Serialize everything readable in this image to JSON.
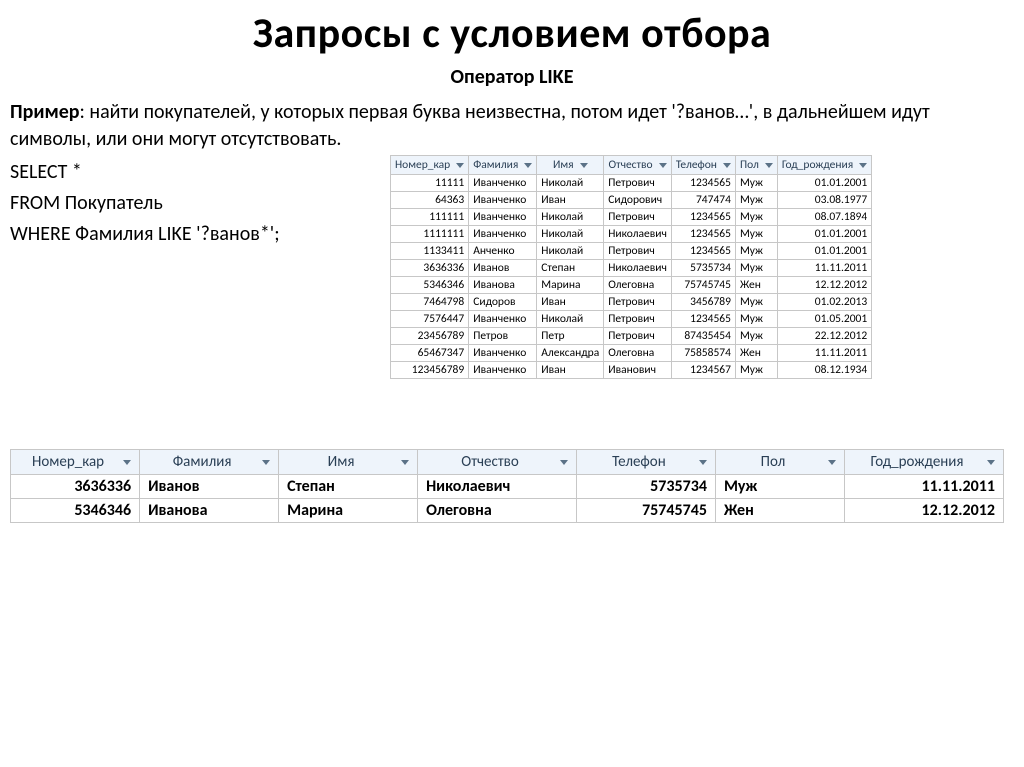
{
  "title": "Запросы с условием отбора",
  "subtitle": "Оператор LIKE",
  "example_label": "Пример",
  "example_text": ": найти покупателей, у которых первая буква неизвестна, потом идет '?ванов…', в дальнейшем идут символы, или они могут отсутствовать.",
  "sql": {
    "l1": "SELECT *",
    "l2": "FROM Покупатель",
    "l3": "WHERE Фамилия LIKE '?ванов*';"
  },
  "columns": {
    "c1": "Номер_кар",
    "c2": "Фамилия",
    "c3": "Имя",
    "c4": "Отчество",
    "c5": "Телефон",
    "c6": "Пол",
    "c7": "Год_рождения"
  },
  "columns_result": {
    "c1": "Номер_кар"
  },
  "rows": [
    {
      "num": "11111",
      "fam": "Иванченко",
      "name": "Николай",
      "otch": "Петрович",
      "tel": "1234565",
      "pol": "Муж",
      "yr": "01.01.2001"
    },
    {
      "num": "64363",
      "fam": "Иванченко",
      "name": "Иван",
      "otch": "Сидорович",
      "tel": "747474",
      "pol": "Муж",
      "yr": "03.08.1977"
    },
    {
      "num": "111111",
      "fam": "Иванченко",
      "name": "Николай",
      "otch": "Петрович",
      "tel": "1234565",
      "pol": "Муж",
      "yr": "08.07.1894"
    },
    {
      "num": "1111111",
      "fam": "Иванченко",
      "name": "Николай",
      "otch": "Николаевич",
      "tel": "1234565",
      "pol": "Муж",
      "yr": "01.01.2001"
    },
    {
      "num": "1133411",
      "fam": "Анченко",
      "name": "Николай",
      "otch": "Петрович",
      "tel": "1234565",
      "pol": "Муж",
      "yr": "01.01.2001"
    },
    {
      "num": "3636336",
      "fam": "Иванов",
      "name": "Степан",
      "otch": "Николаевич",
      "tel": "5735734",
      "pol": "Муж",
      "yr": "11.11.2011"
    },
    {
      "num": "5346346",
      "fam": "Иванова",
      "name": "Марина",
      "otch": "Олеговна",
      "tel": "75745745",
      "pol": "Жен",
      "yr": "12.12.2012"
    },
    {
      "num": "7464798",
      "fam": "Сидоров",
      "name": "Иван",
      "otch": "Петрович",
      "tel": "3456789",
      "pol": "Муж",
      "yr": "01.02.2013"
    },
    {
      "num": "7576447",
      "fam": "Иванченко",
      "name": "Николай",
      "otch": "Петрович",
      "tel": "1234565",
      "pol": "Муж",
      "yr": "01.05.2001"
    },
    {
      "num": "23456789",
      "fam": "Петров",
      "name": "Петр",
      "otch": "Петрович",
      "tel": "87435454",
      "pol": "Муж",
      "yr": "22.12.2012"
    },
    {
      "num": "65467347",
      "fam": "Иванченко",
      "name": "Александра",
      "otch": "Олеговна",
      "tel": "75858574",
      "pol": "Жен",
      "yr": "11.11.2011"
    },
    {
      "num": "123456789",
      "fam": "Иванченко",
      "name": "Иван",
      "otch": "Иванович",
      "tel": "1234567",
      "pol": "Муж",
      "yr": "08.12.1934"
    }
  ],
  "result_rows": [
    {
      "num": "3636336",
      "fam": "Иванов",
      "name": "Степан",
      "otch": "Николаевич",
      "tel": "5735734",
      "pol": "Муж",
      "yr": "11.11.2011"
    },
    {
      "num": "5346346",
      "fam": "Иванова",
      "name": "Марина",
      "otch": "Олеговна",
      "tel": "75745745",
      "pol": "Жен",
      "yr": "12.12.2012"
    }
  ]
}
